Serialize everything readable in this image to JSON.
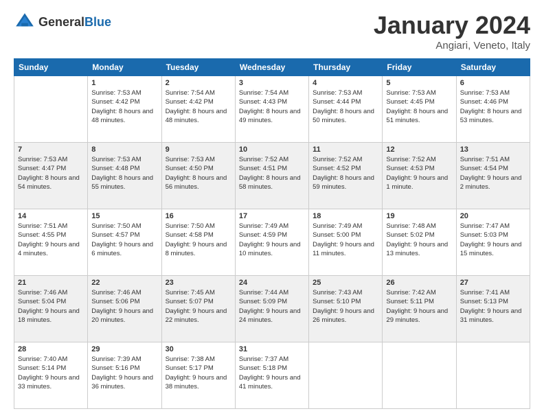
{
  "logo": {
    "general": "General",
    "blue": "Blue"
  },
  "header": {
    "title": "January 2024",
    "subtitle": "Angiari, Veneto, Italy"
  },
  "weekdays": [
    "Sunday",
    "Monday",
    "Tuesday",
    "Wednesday",
    "Thursday",
    "Friday",
    "Saturday"
  ],
  "weeks": [
    [
      {
        "day": "",
        "sunrise": "",
        "sunset": "",
        "daylight": ""
      },
      {
        "day": "1",
        "sunrise": "Sunrise: 7:53 AM",
        "sunset": "Sunset: 4:42 PM",
        "daylight": "Daylight: 8 hours and 48 minutes."
      },
      {
        "day": "2",
        "sunrise": "Sunrise: 7:54 AM",
        "sunset": "Sunset: 4:42 PM",
        "daylight": "Daylight: 8 hours and 48 minutes."
      },
      {
        "day": "3",
        "sunrise": "Sunrise: 7:54 AM",
        "sunset": "Sunset: 4:43 PM",
        "daylight": "Daylight: 8 hours and 49 minutes."
      },
      {
        "day": "4",
        "sunrise": "Sunrise: 7:53 AM",
        "sunset": "Sunset: 4:44 PM",
        "daylight": "Daylight: 8 hours and 50 minutes."
      },
      {
        "day": "5",
        "sunrise": "Sunrise: 7:53 AM",
        "sunset": "Sunset: 4:45 PM",
        "daylight": "Daylight: 8 hours and 51 minutes."
      },
      {
        "day": "6",
        "sunrise": "Sunrise: 7:53 AM",
        "sunset": "Sunset: 4:46 PM",
        "daylight": "Daylight: 8 hours and 53 minutes."
      }
    ],
    [
      {
        "day": "7",
        "sunrise": "Sunrise: 7:53 AM",
        "sunset": "Sunset: 4:47 PM",
        "daylight": "Daylight: 8 hours and 54 minutes."
      },
      {
        "day": "8",
        "sunrise": "Sunrise: 7:53 AM",
        "sunset": "Sunset: 4:48 PM",
        "daylight": "Daylight: 8 hours and 55 minutes."
      },
      {
        "day": "9",
        "sunrise": "Sunrise: 7:53 AM",
        "sunset": "Sunset: 4:50 PM",
        "daylight": "Daylight: 8 hours and 56 minutes."
      },
      {
        "day": "10",
        "sunrise": "Sunrise: 7:52 AM",
        "sunset": "Sunset: 4:51 PM",
        "daylight": "Daylight: 8 hours and 58 minutes."
      },
      {
        "day": "11",
        "sunrise": "Sunrise: 7:52 AM",
        "sunset": "Sunset: 4:52 PM",
        "daylight": "Daylight: 8 hours and 59 minutes."
      },
      {
        "day": "12",
        "sunrise": "Sunrise: 7:52 AM",
        "sunset": "Sunset: 4:53 PM",
        "daylight": "Daylight: 9 hours and 1 minute."
      },
      {
        "day": "13",
        "sunrise": "Sunrise: 7:51 AM",
        "sunset": "Sunset: 4:54 PM",
        "daylight": "Daylight: 9 hours and 2 minutes."
      }
    ],
    [
      {
        "day": "14",
        "sunrise": "Sunrise: 7:51 AM",
        "sunset": "Sunset: 4:55 PM",
        "daylight": "Daylight: 9 hours and 4 minutes."
      },
      {
        "day": "15",
        "sunrise": "Sunrise: 7:50 AM",
        "sunset": "Sunset: 4:57 PM",
        "daylight": "Daylight: 9 hours and 6 minutes."
      },
      {
        "day": "16",
        "sunrise": "Sunrise: 7:50 AM",
        "sunset": "Sunset: 4:58 PM",
        "daylight": "Daylight: 9 hours and 8 minutes."
      },
      {
        "day": "17",
        "sunrise": "Sunrise: 7:49 AM",
        "sunset": "Sunset: 4:59 PM",
        "daylight": "Daylight: 9 hours and 10 minutes."
      },
      {
        "day": "18",
        "sunrise": "Sunrise: 7:49 AM",
        "sunset": "Sunset: 5:00 PM",
        "daylight": "Daylight: 9 hours and 11 minutes."
      },
      {
        "day": "19",
        "sunrise": "Sunrise: 7:48 AM",
        "sunset": "Sunset: 5:02 PM",
        "daylight": "Daylight: 9 hours and 13 minutes."
      },
      {
        "day": "20",
        "sunrise": "Sunrise: 7:47 AM",
        "sunset": "Sunset: 5:03 PM",
        "daylight": "Daylight: 9 hours and 15 minutes."
      }
    ],
    [
      {
        "day": "21",
        "sunrise": "Sunrise: 7:46 AM",
        "sunset": "Sunset: 5:04 PM",
        "daylight": "Daylight: 9 hours and 18 minutes."
      },
      {
        "day": "22",
        "sunrise": "Sunrise: 7:46 AM",
        "sunset": "Sunset: 5:06 PM",
        "daylight": "Daylight: 9 hours and 20 minutes."
      },
      {
        "day": "23",
        "sunrise": "Sunrise: 7:45 AM",
        "sunset": "Sunset: 5:07 PM",
        "daylight": "Daylight: 9 hours and 22 minutes."
      },
      {
        "day": "24",
        "sunrise": "Sunrise: 7:44 AM",
        "sunset": "Sunset: 5:09 PM",
        "daylight": "Daylight: 9 hours and 24 minutes."
      },
      {
        "day": "25",
        "sunrise": "Sunrise: 7:43 AM",
        "sunset": "Sunset: 5:10 PM",
        "daylight": "Daylight: 9 hours and 26 minutes."
      },
      {
        "day": "26",
        "sunrise": "Sunrise: 7:42 AM",
        "sunset": "Sunset: 5:11 PM",
        "daylight": "Daylight: 9 hours and 29 minutes."
      },
      {
        "day": "27",
        "sunrise": "Sunrise: 7:41 AM",
        "sunset": "Sunset: 5:13 PM",
        "daylight": "Daylight: 9 hours and 31 minutes."
      }
    ],
    [
      {
        "day": "28",
        "sunrise": "Sunrise: 7:40 AM",
        "sunset": "Sunset: 5:14 PM",
        "daylight": "Daylight: 9 hours and 33 minutes."
      },
      {
        "day": "29",
        "sunrise": "Sunrise: 7:39 AM",
        "sunset": "Sunset: 5:16 PM",
        "daylight": "Daylight: 9 hours and 36 minutes."
      },
      {
        "day": "30",
        "sunrise": "Sunrise: 7:38 AM",
        "sunset": "Sunset: 5:17 PM",
        "daylight": "Daylight: 9 hours and 38 minutes."
      },
      {
        "day": "31",
        "sunrise": "Sunrise: 7:37 AM",
        "sunset": "Sunset: 5:18 PM",
        "daylight": "Daylight: 9 hours and 41 minutes."
      },
      {
        "day": "",
        "sunrise": "",
        "sunset": "",
        "daylight": ""
      },
      {
        "day": "",
        "sunrise": "",
        "sunset": "",
        "daylight": ""
      },
      {
        "day": "",
        "sunrise": "",
        "sunset": "",
        "daylight": ""
      }
    ]
  ]
}
